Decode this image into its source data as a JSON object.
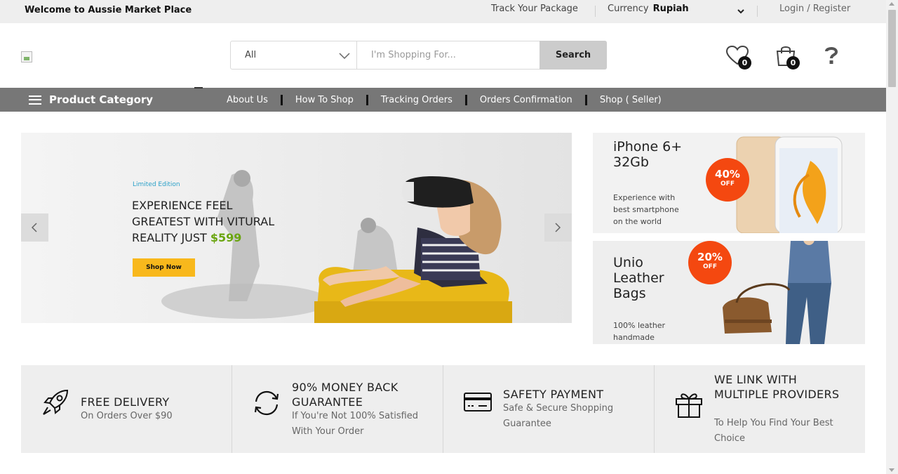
{
  "topbar": {
    "welcome": "Welcome to Aussie Market Place",
    "track": "Track Your Package",
    "currency_label": "Currency",
    "currency_value": "Rupiah",
    "login": "Login / Register"
  },
  "search": {
    "category": "All",
    "placeholder": "I'm Shopping For...",
    "button": "Search"
  },
  "header_icons": {
    "wishlist_count": "0",
    "cart_count": "0"
  },
  "nav": {
    "category": "Product Category",
    "links": [
      "About Us",
      "How To Shop",
      "Tracking Orders",
      "Orders Confirmation",
      "Shop ( Seller)"
    ]
  },
  "slider": {
    "tag": "Limited Edition",
    "headline_1": "EXPERIENCE FEEL",
    "headline_2": "GREATEST WITH VITURAL",
    "headline_3": "REALITY JUST",
    "price": "$599",
    "cta": "Shop Now"
  },
  "banners": [
    {
      "title_1": "iPhone 6+",
      "title_2": "32Gb",
      "discount": "40%",
      "off": "OFF",
      "desc_1": "Experience with",
      "desc_2": "best smartphone",
      "desc_3": "on the world"
    },
    {
      "title_1": "Unio",
      "title_2": "Leather",
      "title_3": "Bags",
      "discount": "20%",
      "off": "OFF",
      "desc_1": "100% leather",
      "desc_2": "handmade"
    }
  ],
  "features": [
    {
      "title": "FREE DELIVERY",
      "sub": "On Orders Over $90",
      "icon": "rocket-icon"
    },
    {
      "title": "90% MONEY BACK GUARANTEE",
      "sub": "If You're Not 100% Satisfied With Your Order",
      "icon": "refresh-icon"
    },
    {
      "title": "SAFETY PAYMENT",
      "sub": "Safe & Secure Shopping Guarantee",
      "icon": "credit-card-icon"
    },
    {
      "title": "WE LINK WITH MULTIPLE PROVIDERS",
      "sub": "To Help You Find Your Best Choice",
      "icon": "gift-icon"
    }
  ],
  "colors": {
    "topbar_bg": "#eeeeee",
    "nav_bg": "#777777",
    "search_button": "#cccccc",
    "cta": "#f8b81c",
    "price": "#6aa510",
    "discount": "#f44810"
  }
}
